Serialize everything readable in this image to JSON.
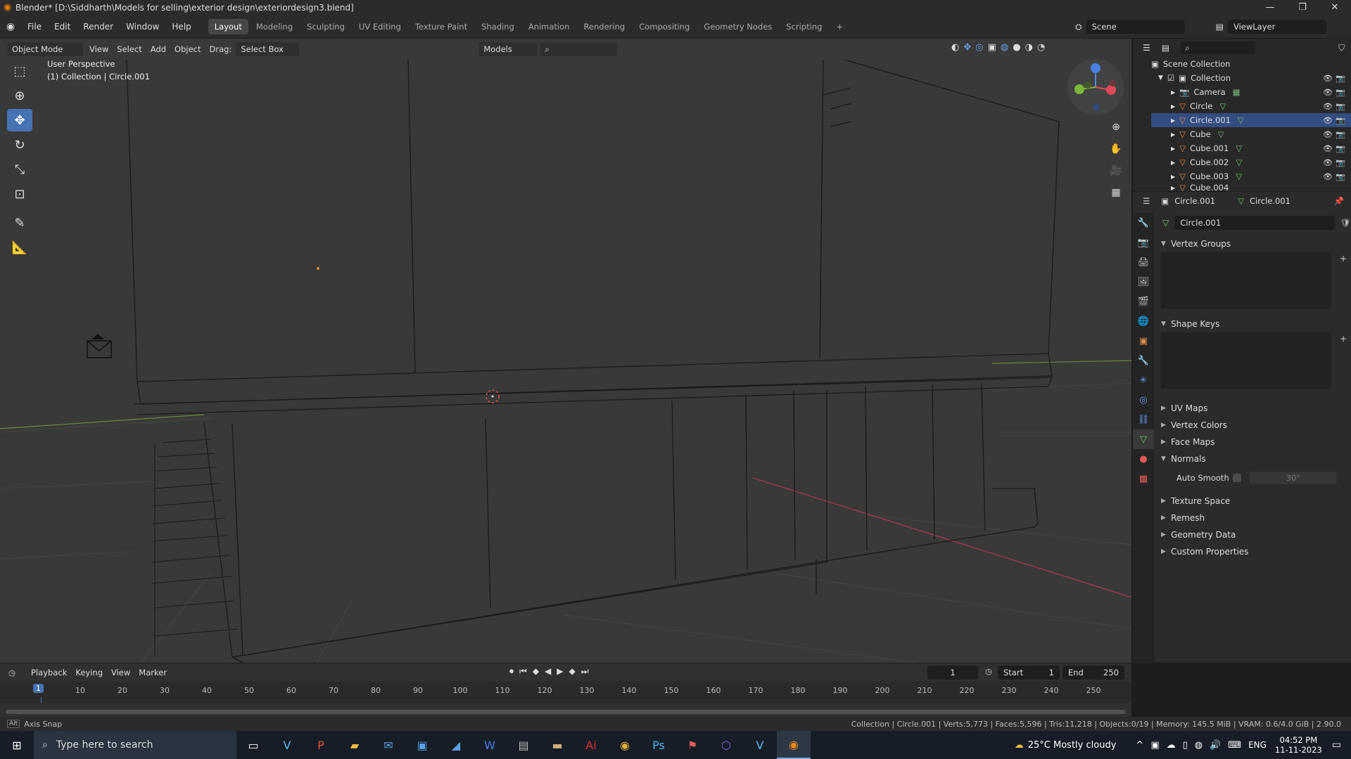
{
  "window": {
    "title": "Blender* [D:\\Siddharth\\Models for selling\\exterior design\\exteriordesign3.blend]",
    "minimize": "—",
    "restore": "❐",
    "close": "✕"
  },
  "menu": {
    "items": [
      "File",
      "Edit",
      "Render",
      "Window",
      "Help"
    ]
  },
  "workspaces": {
    "tabs": [
      "Layout",
      "Modeling",
      "Sculpting",
      "UV Editing",
      "Texture Paint",
      "Shading",
      "Animation",
      "Rendering",
      "Compositing",
      "Geometry Nodes",
      "Scripting"
    ],
    "add": "+"
  },
  "scene": {
    "name": "Scene",
    "view_layer": "ViewLayer"
  },
  "viewport_header": {
    "mode": "Object Mode",
    "view": "View",
    "select": "Select",
    "add": "Add",
    "object": "Object",
    "drag_label": "Drag:",
    "drag_value": "Select Box",
    "models": "Models"
  },
  "viewport": {
    "perspective": "User Perspective",
    "collection_info": "(1) Collection | Circle.001"
  },
  "outliner": {
    "root": "Scene Collection",
    "collection": "Collection",
    "items": [
      "Camera",
      "Circle",
      "Circle.001",
      "Cube",
      "Cube.001",
      "Cube.002",
      "Cube.003",
      "Cube.004"
    ]
  },
  "properties": {
    "object_name": "Circle.001",
    "data_name": "Circle.001",
    "mesh_field": "Circle.001",
    "panels": {
      "vertex_groups": "Vertex Groups",
      "shape_keys": "Shape Keys",
      "uv_maps": "UV Maps",
      "vertex_colors": "Vertex Colors",
      "face_maps": "Face Maps",
      "normals": "Normals",
      "auto_smooth": "Auto Smooth",
      "auto_smooth_angle": "30°",
      "texture_space": "Texture Space",
      "remesh": "Remesh",
      "geometry_data": "Geometry Data",
      "custom_properties": "Custom Properties"
    }
  },
  "timeline": {
    "menus": [
      "Playback",
      "Keying",
      "View",
      "Marker"
    ],
    "current_frame": "1",
    "start_label": "Start",
    "start": "1",
    "end_label": "End",
    "end": "250",
    "playhead": "1",
    "ticks": [
      "10",
      "20",
      "30",
      "40",
      "50",
      "60",
      "70",
      "80",
      "90",
      "100",
      "110",
      "120",
      "130",
      "140",
      "150",
      "160",
      "170",
      "180",
      "190",
      "200",
      "210",
      "220",
      "230",
      "240",
      "250"
    ]
  },
  "status": {
    "left": "Axis Snap",
    "right": "Collection | Circle.001 | Verts:5,773 | Faces:5,596 | Tris:11,218 | Objects:0/19 | Memory: 145.5 MiB | VRAM: 0.6/4.0 GiB | 2.90.0"
  },
  "taskbar": {
    "search_placeholder": "Type here to search",
    "weather": "25°C  Mostly cloudy",
    "lang": "ENG",
    "time": "04:52 PM",
    "date": "11-11-2023"
  }
}
